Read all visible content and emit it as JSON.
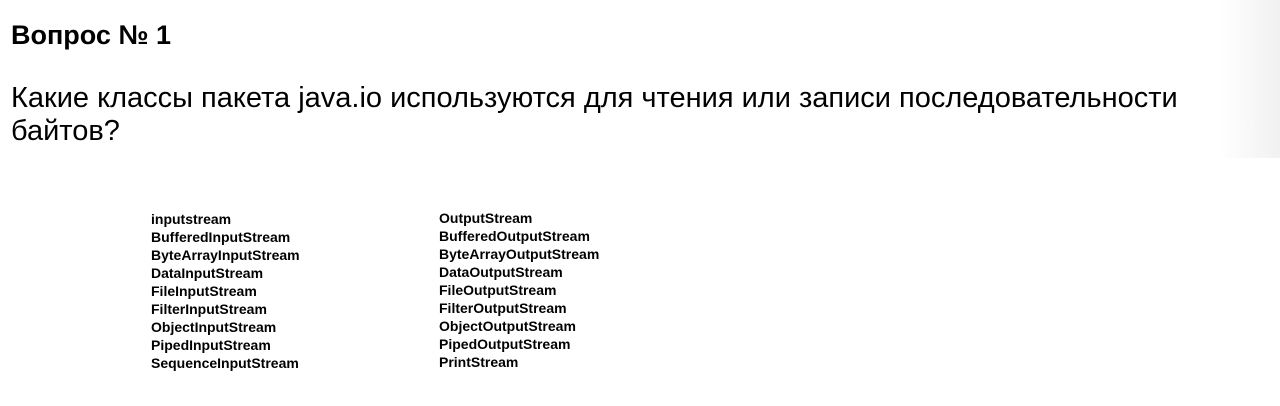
{
  "title": "Вопрос № 1",
  "question": "Какие классы пакета java.io используются для чтения или записи последовательности байтов?",
  "input_classes": [
    "inputstream",
    "BufferedInputStream",
    "ByteArrayInputStream",
    "DataInputStream",
    "FileInputStream",
    "FilterInputStream",
    "ObjectInputStream",
    "PipedInputStream",
    "SequenceInputStream"
  ],
  "output_classes": [
    "OutputStream",
    "BufferedOutputStream",
    "ByteArrayOutputStream",
    "DataOutputStream",
    "FileOutputStream",
    "FilterOutputStream",
    "ObjectOutputStream",
    "PipedOutputStream",
    "PrintStream"
  ]
}
